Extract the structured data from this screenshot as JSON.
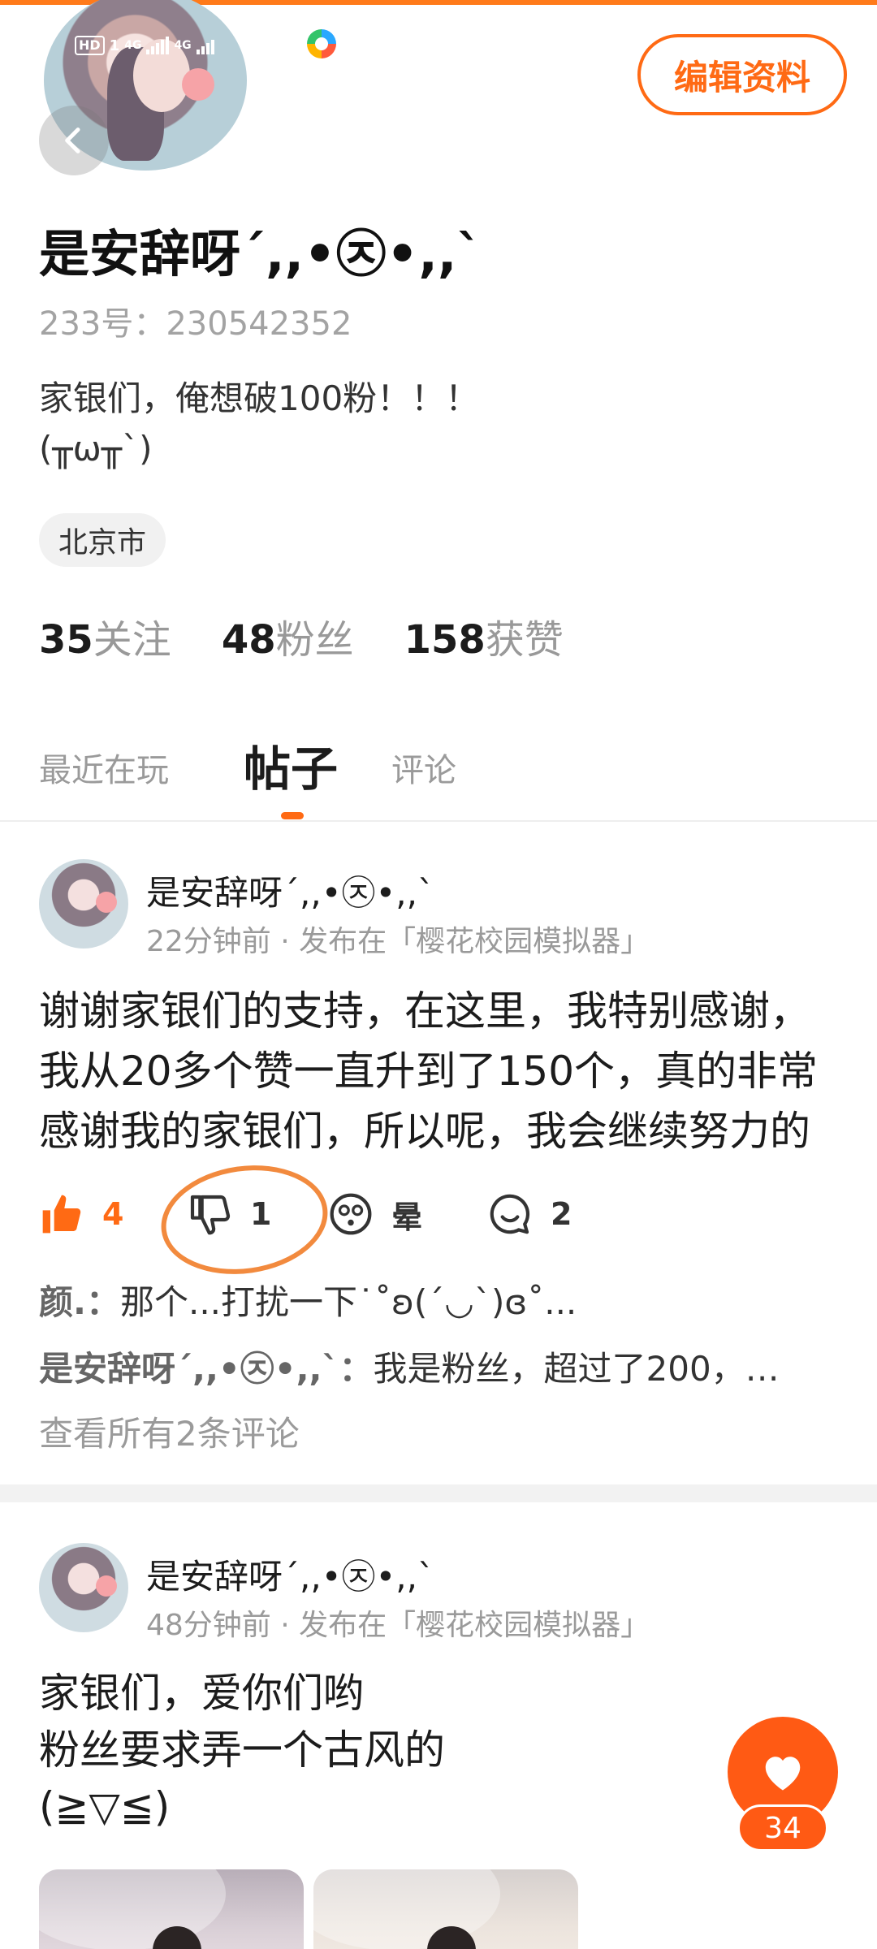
{
  "status_bar": {
    "hd": "HD",
    "sim": "1",
    "net1": "4G",
    "net2": "4G"
  },
  "header": {
    "edit_profile_label": "编辑资料"
  },
  "profile": {
    "name": "是安辞呀´,,•㉨•,,`",
    "id_text": "233号：230542352",
    "bio": "家银们，俺想破100粉！！！\n(╥ω╥`)",
    "location": "北京市",
    "stats": [
      {
        "num": "35",
        "label": "关注"
      },
      {
        "num": "48",
        "label": "粉丝"
      },
      {
        "num": "158",
        "label": "获赞"
      }
    ]
  },
  "tabs": {
    "recent": "最近在玩",
    "posts": "帖子",
    "comments": "评论"
  },
  "posts": [
    {
      "author": "是安辞呀´,,•㉨•,,`",
      "meta": "22分钟前 · 发布在「樱花校园模拟器」",
      "text": "谢谢家银们的支持，在这里，我特别感谢，我从20多个赞一直升到了150个，真的非常感谢我的家银们，所以呢，我会继续努力的",
      "likes": "4",
      "dislikes": "1",
      "dizzy_label": "晕",
      "comments_count": "2",
      "comments": [
        {
          "author": "颜.：",
          "text": "那个...打扰一下˙˚ʚ(´◡`)ɞ˚..."
        },
        {
          "author": "是安辞呀´,,•㉨•,,`：",
          "text": "我是粉丝，超过了200，…"
        }
      ],
      "view_all": "查看所有2条评论"
    },
    {
      "author": "是安辞呀´,,•㉨•,,`",
      "meta": "48分钟前 · 发布在「樱花校园模拟器」",
      "text": "家银们，爱你们哟\n粉丝要求弄一个古风的\n(≧▽≦)"
    }
  ],
  "fab": {
    "like_count": "34"
  },
  "colors": {
    "accent": "#ff6a14",
    "annotation": "#f28a3e"
  },
  "icons": [
    "back-icon",
    "thumbs-up-icon",
    "thumbs-down-icon",
    "dizzy-icon",
    "comment-icon",
    "heart-icon"
  ]
}
